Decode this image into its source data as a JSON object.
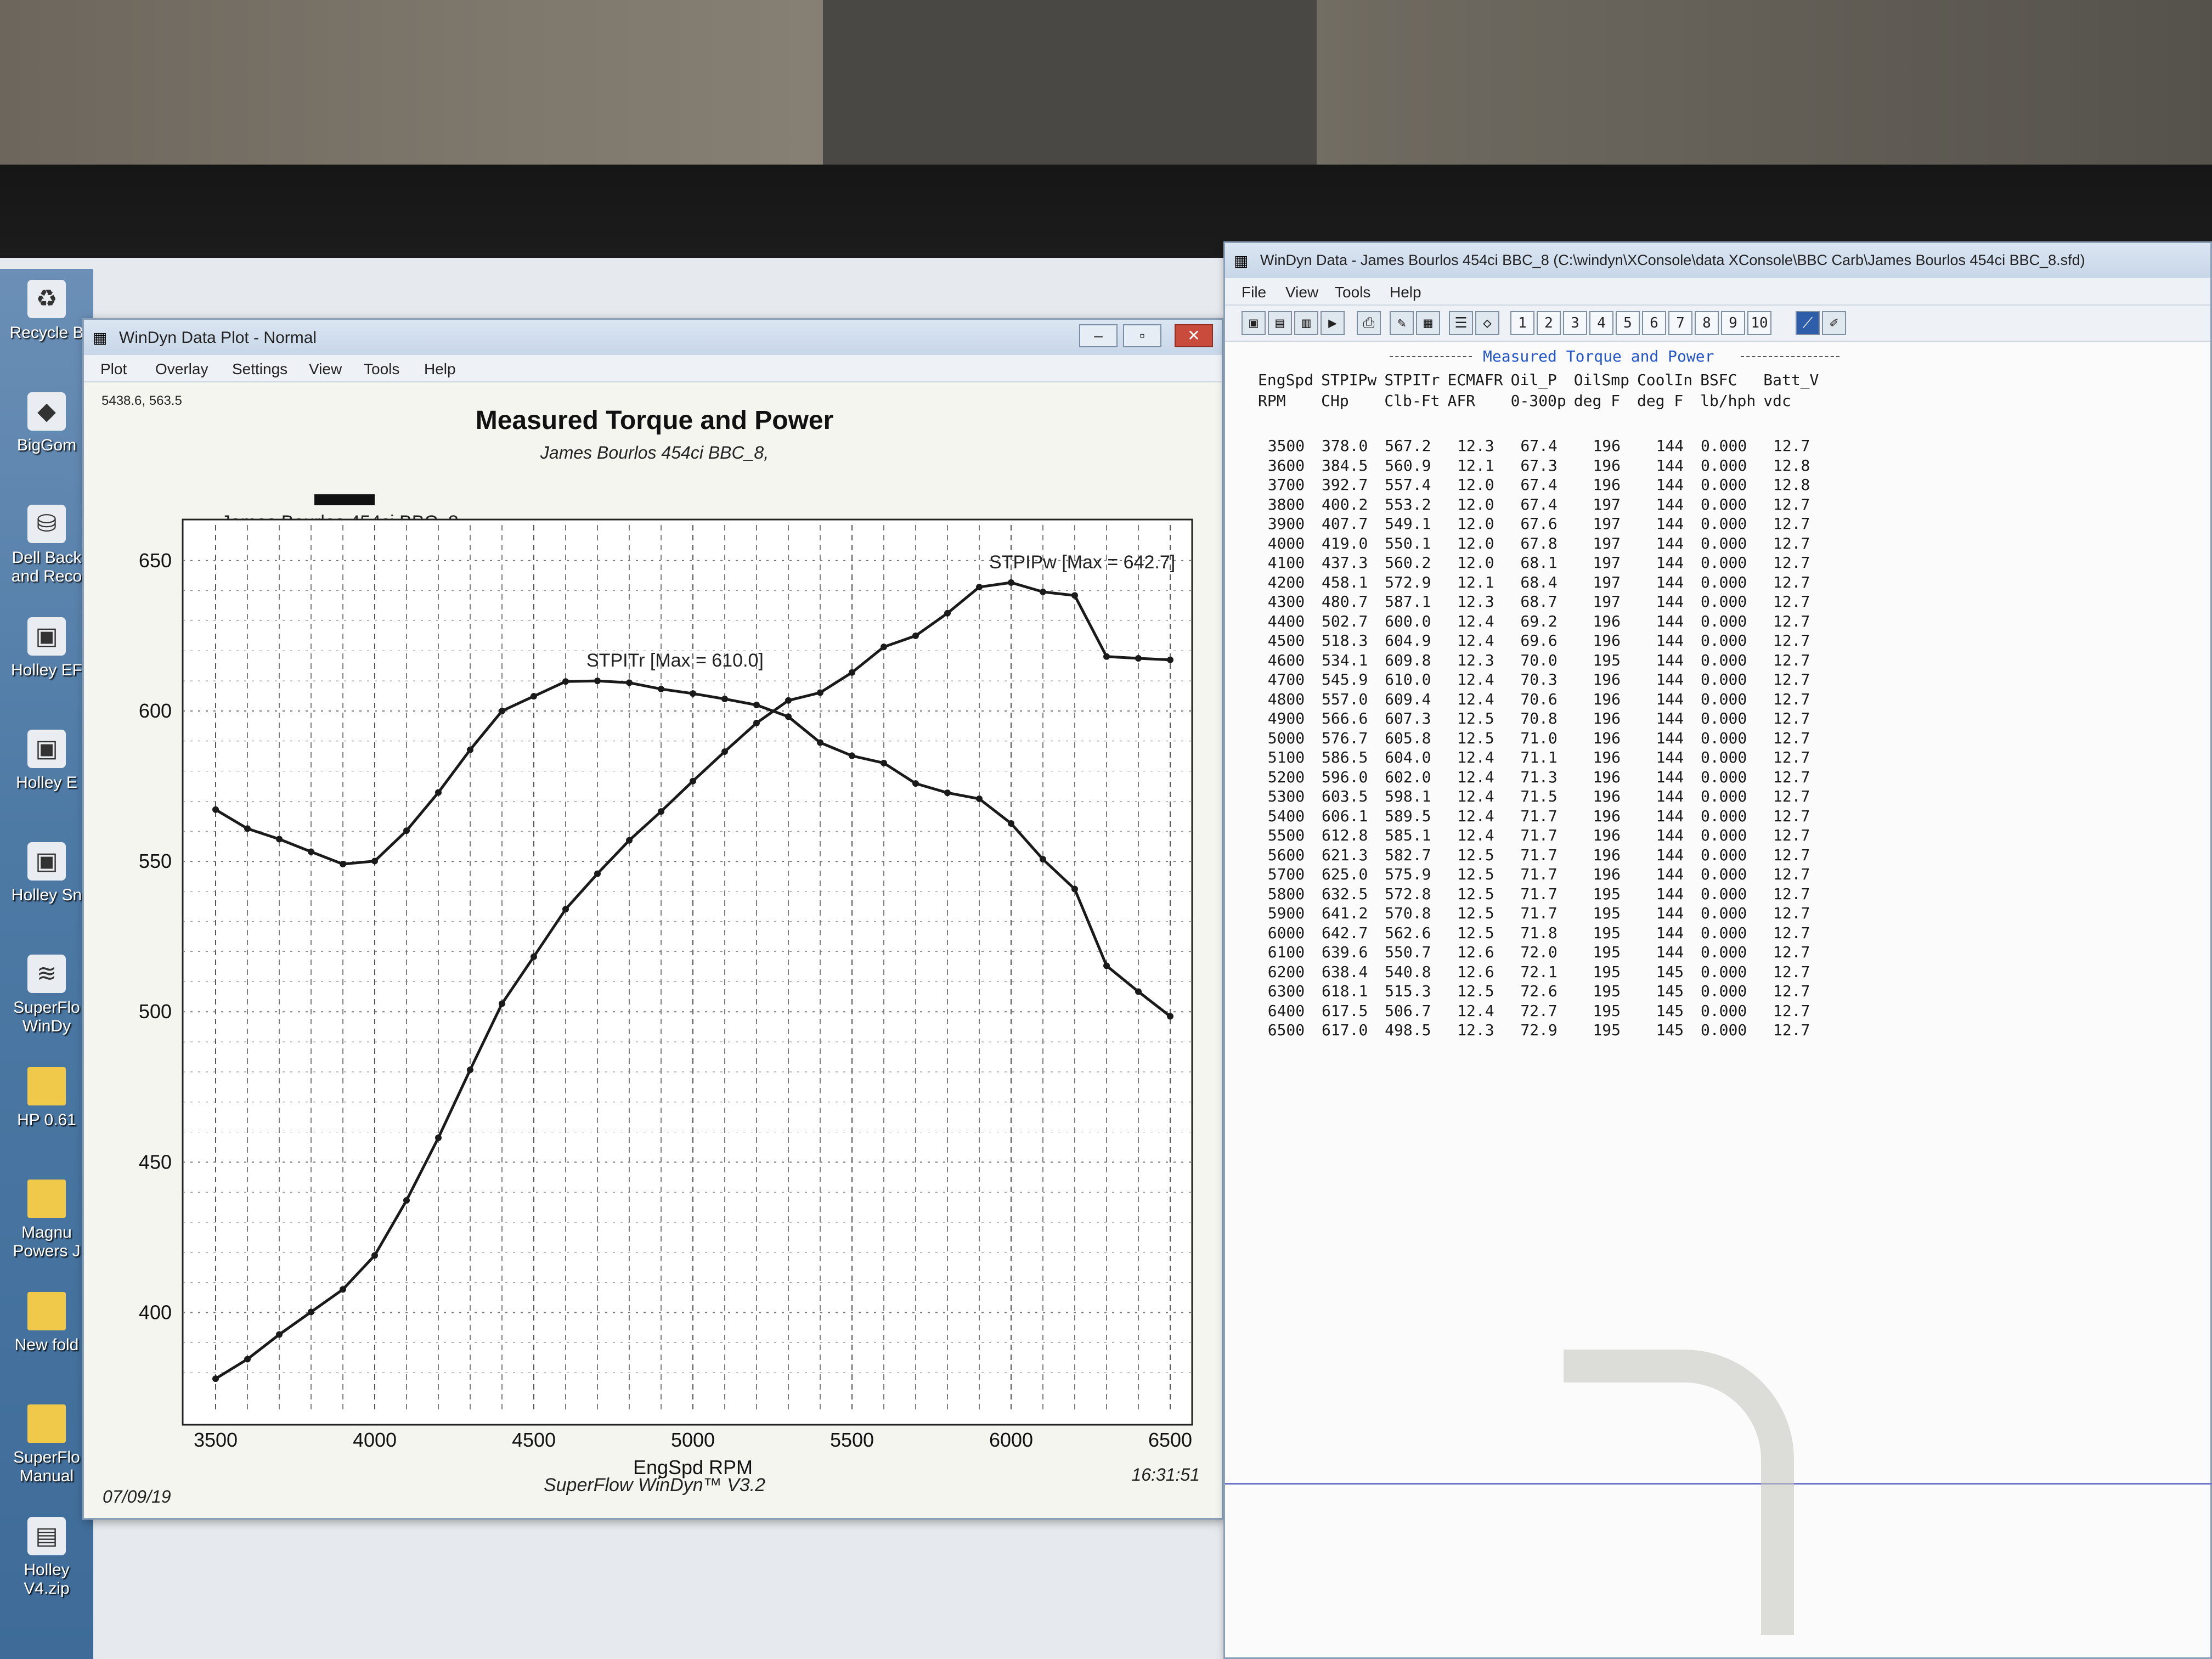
{
  "plot_window": {
    "title": "WinDyn Data Plot - Normal",
    "menus": [
      "Plot",
      "Overlay",
      "Settings",
      "View",
      "Tools",
      "Help"
    ],
    "cursor_readout": "5438.6, 563.5",
    "run_label": "James Bourlos 454ci BBC_8",
    "date": "07/09/19",
    "time": "16:31:51",
    "footer": "SuperFlow WinDyn™ V3.2"
  },
  "data_window": {
    "title": "WinDyn Data - James Bourlos 454ci BBC_8  (C:\\windyn\\XConsole\\data XConsole\\BBC Carb\\James Bourlos 454ci BBC_8.sfd)",
    "menus": [
      "File",
      "View",
      "Tools",
      "Help"
    ],
    "pages": [
      "1",
      "2",
      "3",
      "4",
      "5",
      "6",
      "7",
      "8",
      "9",
      "10"
    ],
    "table_title": "Measured Torque and Power",
    "header_top": [
      "EngSpd",
      "STPIPw",
      "STPITr",
      "ECMAFR",
      "Oil_P",
      "OilSmp",
      "CoolIn",
      "BSFC",
      "Batt_V"
    ],
    "header_units": [
      "RPM",
      "CHp",
      "Clb-Ft",
      "AFR",
      "0-300p",
      "deg F",
      "deg F",
      "lb/hph",
      "vdc"
    ],
    "rows": [
      [
        "3500",
        "378.0",
        "567.2",
        "12.3",
        "67.4",
        "196",
        "144",
        "0.000",
        "12.7"
      ],
      [
        "3600",
        "384.5",
        "560.9",
        "12.1",
        "67.3",
        "196",
        "144",
        "0.000",
        "12.8"
      ],
      [
        "3700",
        "392.7",
        "557.4",
        "12.0",
        "67.4",
        "196",
        "144",
        "0.000",
        "12.8"
      ],
      [
        "3800",
        "400.2",
        "553.2",
        "12.0",
        "67.4",
        "197",
        "144",
        "0.000",
        "12.7"
      ],
      [
        "3900",
        "407.7",
        "549.1",
        "12.0",
        "67.6",
        "197",
        "144",
        "0.000",
        "12.7"
      ],
      [
        "4000",
        "419.0",
        "550.1",
        "12.0",
        "67.8",
        "197",
        "144",
        "0.000",
        "12.7"
      ],
      [
        "4100",
        "437.3",
        "560.2",
        "12.0",
        "68.1",
        "197",
        "144",
        "0.000",
        "12.7"
      ],
      [
        "4200",
        "458.1",
        "572.9",
        "12.1",
        "68.4",
        "197",
        "144",
        "0.000",
        "12.7"
      ],
      [
        "4300",
        "480.7",
        "587.1",
        "12.3",
        "68.7",
        "197",
        "144",
        "0.000",
        "12.7"
      ],
      [
        "4400",
        "502.7",
        "600.0",
        "12.4",
        "69.2",
        "196",
        "144",
        "0.000",
        "12.7"
      ],
      [
        "4500",
        "518.3",
        "604.9",
        "12.4",
        "69.6",
        "196",
        "144",
        "0.000",
        "12.7"
      ],
      [
        "4600",
        "534.1",
        "609.8",
        "12.3",
        "70.0",
        "195",
        "144",
        "0.000",
        "12.7"
      ],
      [
        "4700",
        "545.9",
        "610.0",
        "12.4",
        "70.3",
        "196",
        "144",
        "0.000",
        "12.7"
      ],
      [
        "4800",
        "557.0",
        "609.4",
        "12.4",
        "70.6",
        "196",
        "144",
        "0.000",
        "12.7"
      ],
      [
        "4900",
        "566.6",
        "607.3",
        "12.5",
        "70.8",
        "196",
        "144",
        "0.000",
        "12.7"
      ],
      [
        "5000",
        "576.7",
        "605.8",
        "12.5",
        "71.0",
        "196",
        "144",
        "0.000",
        "12.7"
      ],
      [
        "5100",
        "586.5",
        "604.0",
        "12.4",
        "71.1",
        "196",
        "144",
        "0.000",
        "12.7"
      ],
      [
        "5200",
        "596.0",
        "602.0",
        "12.4",
        "71.3",
        "196",
        "144",
        "0.000",
        "12.7"
      ],
      [
        "5300",
        "603.5",
        "598.1",
        "12.4",
        "71.5",
        "196",
        "144",
        "0.000",
        "12.7"
      ],
      [
        "5400",
        "606.1",
        "589.5",
        "12.4",
        "71.7",
        "196",
        "144",
        "0.000",
        "12.7"
      ],
      [
        "5500",
        "612.8",
        "585.1",
        "12.4",
        "71.7",
        "196",
        "144",
        "0.000",
        "12.7"
      ],
      [
        "5600",
        "621.3",
        "582.7",
        "12.5",
        "71.7",
        "196",
        "144",
        "0.000",
        "12.7"
      ],
      [
        "5700",
        "625.0",
        "575.9",
        "12.5",
        "71.7",
        "196",
        "144",
        "0.000",
        "12.7"
      ],
      [
        "5800",
        "632.5",
        "572.8",
        "12.5",
        "71.7",
        "195",
        "144",
        "0.000",
        "12.7"
      ],
      [
        "5900",
        "641.2",
        "570.8",
        "12.5",
        "71.7",
        "195",
        "144",
        "0.000",
        "12.7"
      ],
      [
        "6000",
        "642.7",
        "562.6",
        "12.5",
        "71.8",
        "195",
        "144",
        "0.000",
        "12.7"
      ],
      [
        "6100",
        "639.6",
        "550.7",
        "12.6",
        "72.0",
        "195",
        "144",
        "0.000",
        "12.7"
      ],
      [
        "6200",
        "638.4",
        "540.8",
        "12.6",
        "72.1",
        "195",
        "145",
        "0.000",
        "12.7"
      ],
      [
        "6300",
        "618.1",
        "515.3",
        "12.5",
        "72.6",
        "195",
        "145",
        "0.000",
        "12.7"
      ],
      [
        "6400",
        "617.5",
        "506.7",
        "12.4",
        "72.7",
        "195",
        "145",
        "0.000",
        "12.7"
      ],
      [
        "6500",
        "617.0",
        "498.5",
        "12.3",
        "72.9",
        "195",
        "145",
        "0.000",
        "12.7"
      ]
    ]
  },
  "desktop_icons": [
    {
      "label": "Recycle B",
      "icon": "recycle-bin-icon"
    },
    {
      "label": "BigGom",
      "icon": "app-icon"
    },
    {
      "label": "Dell Back and Reco",
      "icon": "backup-icon"
    },
    {
      "label": "Holley EF",
      "icon": "holley-icon"
    },
    {
      "label": "Holley E",
      "icon": "holley-icon"
    },
    {
      "label": "Holley Sn",
      "icon": "holley-icon"
    },
    {
      "label": "SuperFlo WinDy",
      "icon": "superflow-icon"
    },
    {
      "label": "HP 0.61",
      "icon": "folder-icon"
    },
    {
      "label": "Magnu Powers J",
      "icon": "folder-icon"
    },
    {
      "label": "New fold",
      "icon": "folder-icon"
    },
    {
      "label": "SuperFlo Manual",
      "icon": "folder-icon"
    },
    {
      "label": "Holley V4.zip",
      "icon": "zip-icon"
    }
  ],
  "chart_data": {
    "type": "line",
    "title": "Measured Torque and Power",
    "subtitle": "James Bourlos 454ci BBC_8,",
    "xlabel": "EngSpd RPM",
    "ylabel": "",
    "xlim": [
      3500,
      6500
    ],
    "ylim": [
      370,
      660
    ],
    "x_ticks": [
      "3500",
      "4000",
      "4500",
      "5000",
      "5500",
      "6000",
      "6500"
    ],
    "y_ticks": [
      "400",
      "450",
      "500",
      "550",
      "600",
      "650"
    ],
    "grid": true,
    "x": [
      3500,
      3600,
      3700,
      3800,
      3900,
      4000,
      4100,
      4200,
      4300,
      4400,
      4500,
      4600,
      4700,
      4800,
      4900,
      5000,
      5100,
      5200,
      5300,
      5400,
      5500,
      5600,
      5700,
      5800,
      5900,
      6000,
      6100,
      6200,
      6300,
      6400,
      6500
    ],
    "series": [
      {
        "name": "STPIPw",
        "label": "STPIPw [Max = 642.7]",
        "values": [
          378.0,
          384.5,
          392.7,
          400.2,
          407.7,
          419.0,
          437.3,
          458.1,
          480.7,
          502.7,
          518.3,
          534.1,
          545.9,
          557.0,
          566.6,
          576.7,
          586.5,
          596.0,
          603.5,
          606.1,
          612.8,
          621.3,
          625.0,
          632.5,
          641.2,
          642.7,
          639.6,
          638.4,
          618.1,
          617.5,
          617.0
        ]
      },
      {
        "name": "STPITr",
        "label": "STPITr [Max = 610.0]",
        "values": [
          567.2,
          560.9,
          557.4,
          553.2,
          549.1,
          550.1,
          560.2,
          572.9,
          587.1,
          600.0,
          604.9,
          609.8,
          610.0,
          609.4,
          607.3,
          605.8,
          604.0,
          602.0,
          598.1,
          589.5,
          585.1,
          582.7,
          575.9,
          572.8,
          570.8,
          562.6,
          550.7,
          540.8,
          515.3,
          506.7,
          498.5
        ]
      }
    ]
  }
}
